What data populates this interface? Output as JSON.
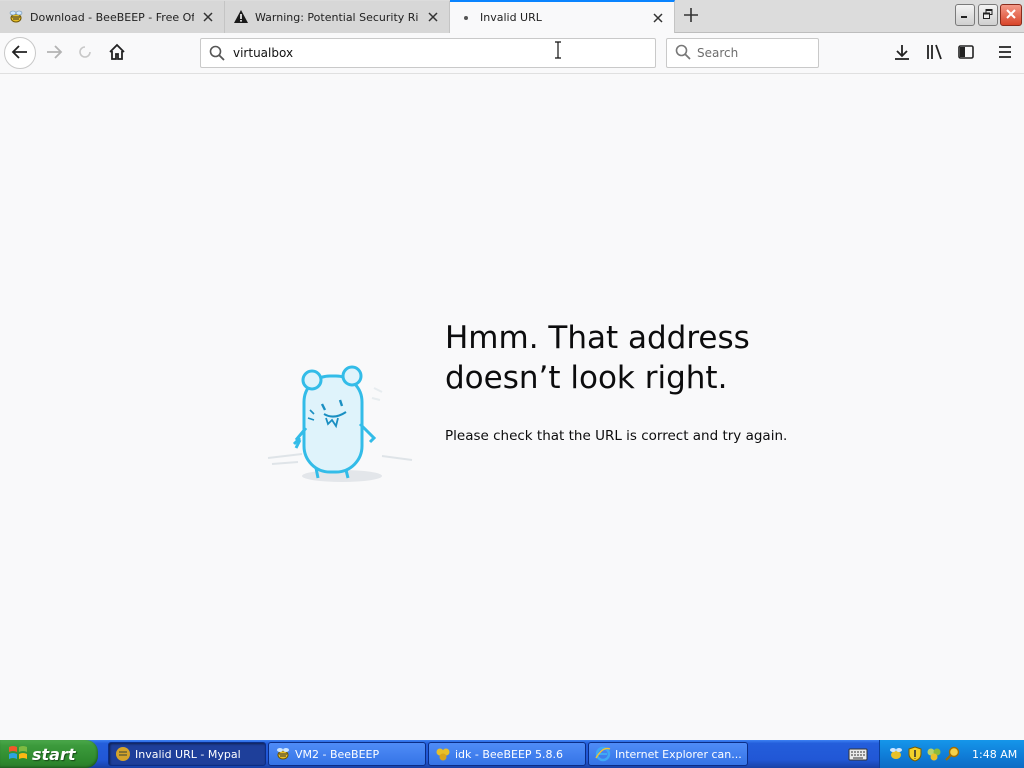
{
  "tabs": [
    {
      "title": "Download - BeeBEEP - Free Office Messenger",
      "icon": "beebeep-icon",
      "state": "inactive"
    },
    {
      "title": "Warning: Potential Security Risk Ahead",
      "icon": "warning-icon",
      "state": "inactive"
    },
    {
      "title": "Invalid URL",
      "icon": "dot-icon",
      "state": "selected"
    }
  ],
  "urlbar": {
    "value": "virtualbox"
  },
  "searchbar": {
    "placeholder": "Search"
  },
  "error_page": {
    "title": "Hmm. That address doesn’t look right.",
    "message": "Please check that the URL is correct and try again."
  },
  "taskbar": {
    "start_label": "start",
    "tasks": [
      {
        "label": "Invalid URL - Mypal",
        "icon": "mypal-icon",
        "active": true
      },
      {
        "label": "VM2 - BeeBEEP",
        "icon": "beebeep-icon",
        "active": false
      },
      {
        "label": "idk - BeeBEEP 5.8.6",
        "icon": "beebeep-group-icon",
        "active": false
      },
      {
        "label": "Internet Explorer can...",
        "icon": "internet-explorer-icon",
        "active": false
      }
    ],
    "clock": "1:48 AM"
  },
  "colors": {
    "tab_accent": "#0a84ff",
    "page_background": "#f9f9fa",
    "taskbar_blue": "#245edb",
    "start_green": "#3c9a3c"
  }
}
